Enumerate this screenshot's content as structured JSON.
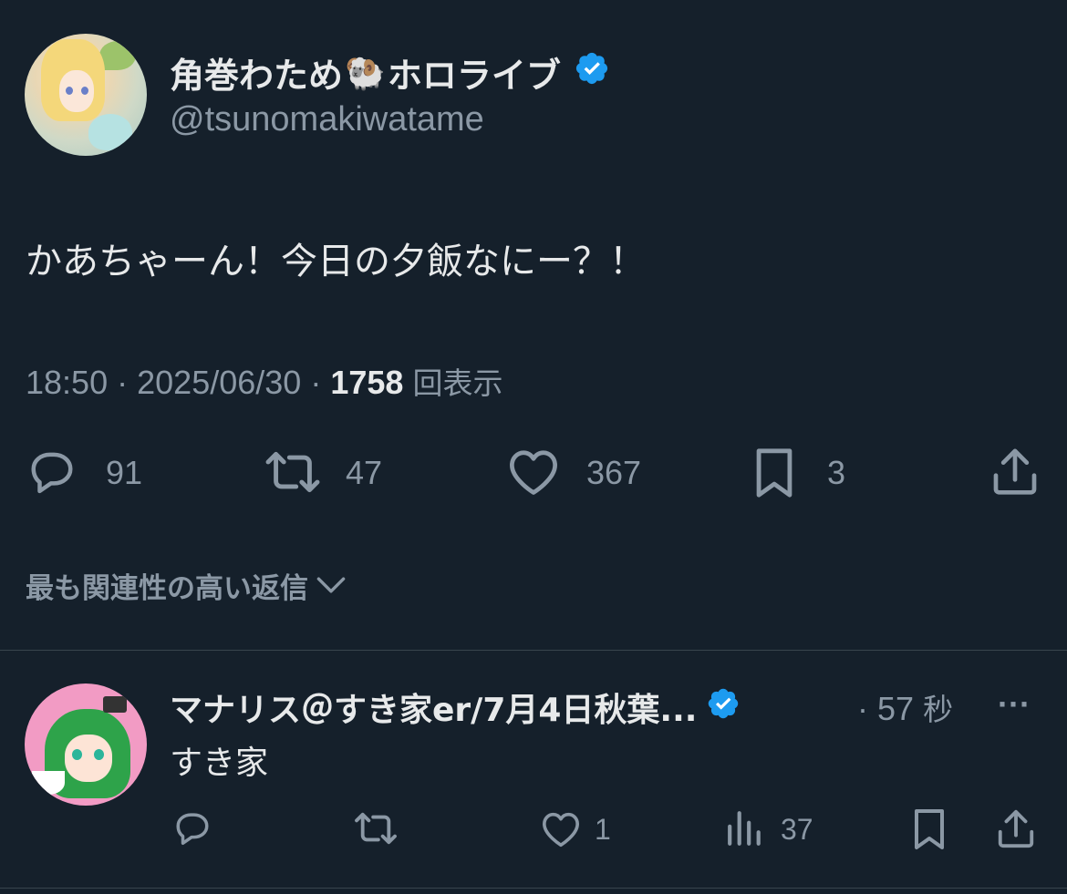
{
  "colors": {
    "background": "#15202b",
    "text_primary": "#e7e9ea",
    "text_secondary": "#8b98a5",
    "verified_badge": "#1d9bf0",
    "divider": "#38444d"
  },
  "tweet": {
    "author": {
      "display_name": "角巻わため",
      "name_emoji": "🐏",
      "display_name_suffix": "ホロライブ",
      "handle": "@tsunomakiwatame",
      "verified": true
    },
    "text": "かあちゃーん！今日の夕飯なにー？！",
    "time": "18:50",
    "separator": "·",
    "date": "2025/06/30",
    "views_count": "1758",
    "views_label": "回表示",
    "actions": {
      "replies": "91",
      "retweets": "47",
      "likes": "367",
      "bookmarks": "3"
    }
  },
  "sort": {
    "label": "最も関連性の高い返信",
    "icon": "chevron-down-icon"
  },
  "reply": {
    "author": {
      "display_name": "マナリス＠すき家er/7月4日秋葉...",
      "verified": true
    },
    "separator": "·",
    "time_value": "57",
    "time_unit": "秒",
    "more_icon": "···",
    "text": "すき家",
    "actions": {
      "replies": "",
      "retweets": "",
      "likes": "1",
      "views": "37"
    }
  }
}
